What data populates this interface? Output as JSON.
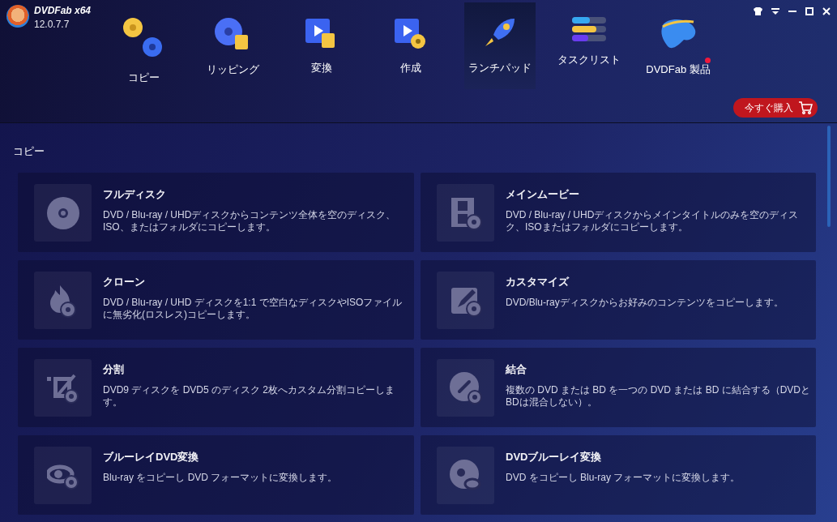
{
  "app": {
    "name": "DVDFab x64",
    "version": "12.0.7.7"
  },
  "nav": [
    {
      "label": "コピー",
      "selected": false,
      "notification": false
    },
    {
      "label": "リッピング",
      "selected": false,
      "notification": false
    },
    {
      "label": "変換",
      "selected": false,
      "notification": false
    },
    {
      "label": "作成",
      "selected": false,
      "notification": false
    },
    {
      "label": "ランチパッド",
      "selected": true,
      "notification": false
    },
    {
      "label": "タスクリスト",
      "selected": false,
      "notification": false
    },
    {
      "label": "DVDFab 製品",
      "selected": false,
      "notification": true
    }
  ],
  "buy_button": "今すぐ購入",
  "section": {
    "title": "コピー",
    "cards": [
      {
        "title": "フルディスク",
        "description": "DVD / Blu-ray / UHDディスクからコンテンツ全体を空のディスク、ISO、またはフォルダにコピーします。"
      },
      {
        "title": "メインムービー",
        "description": "DVD / Blu-ray / UHDディスクからメインタイトルのみを空のディスク、ISOまたはフォルダにコピーします。"
      },
      {
        "title": "クローン",
        "description": "DVD / Blu-ray / UHD ディスクを1:1 で空白なディスクやISOファイルに無劣化(ロスレス)コピーします。"
      },
      {
        "title": "カスタマイズ",
        "description": "DVD/Blu-rayディスクからお好みのコンテンツをコピーします。"
      },
      {
        "title": "分割",
        "description": "DVD9 ディスクを DVD5 のディスク 2枚へカスタム分割コピーします。"
      },
      {
        "title": "結合",
        "description": "複数の DVD または BD を一つの DVD または BD に結合する（DVDとBDは混合しない）。"
      },
      {
        "title": "ブルーレイDVD変換",
        "description": "Blu-ray をコピーし DVD フォーマットに変換します。"
      },
      {
        "title": "DVDブルーレイ変換",
        "description": "DVD をコピーし Blu-ray フォーマットに変換します。"
      }
    ]
  }
}
